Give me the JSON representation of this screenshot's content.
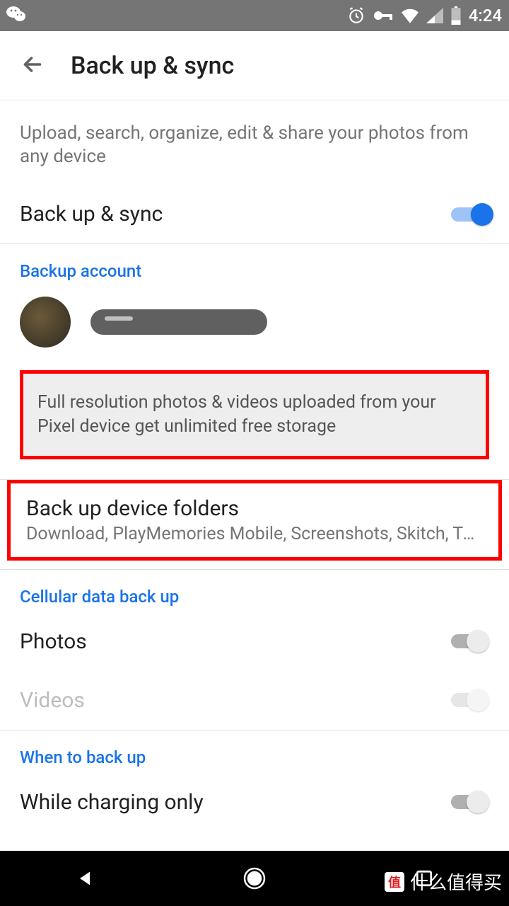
{
  "status": {
    "time": "4:24"
  },
  "header": {
    "title": "Back up & sync"
  },
  "intro": "Upload, search, organize, edit & share your photos from any device",
  "backup_sync": {
    "label": "Back up & sync",
    "enabled": true
  },
  "backup_account": {
    "heading": "Backup account"
  },
  "info_banner": "Full resolution photos & videos uploaded from your Pixel device get unlimited free storage",
  "device_folders": {
    "title": "Back up device folders",
    "subtitle": "Download, PlayMemories Mobile, Screenshots, Skitch, Twit…"
  },
  "cellular": {
    "heading": "Cellular data back up",
    "photos": {
      "label": "Photos",
      "enabled": false
    },
    "videos": {
      "label": "Videos",
      "enabled": false,
      "disabled_visual": true
    }
  },
  "when": {
    "heading": "When to back up",
    "charging": {
      "label": "While charging only",
      "enabled": false
    }
  },
  "watermark": {
    "badge": "值",
    "text": "什么值得买"
  }
}
